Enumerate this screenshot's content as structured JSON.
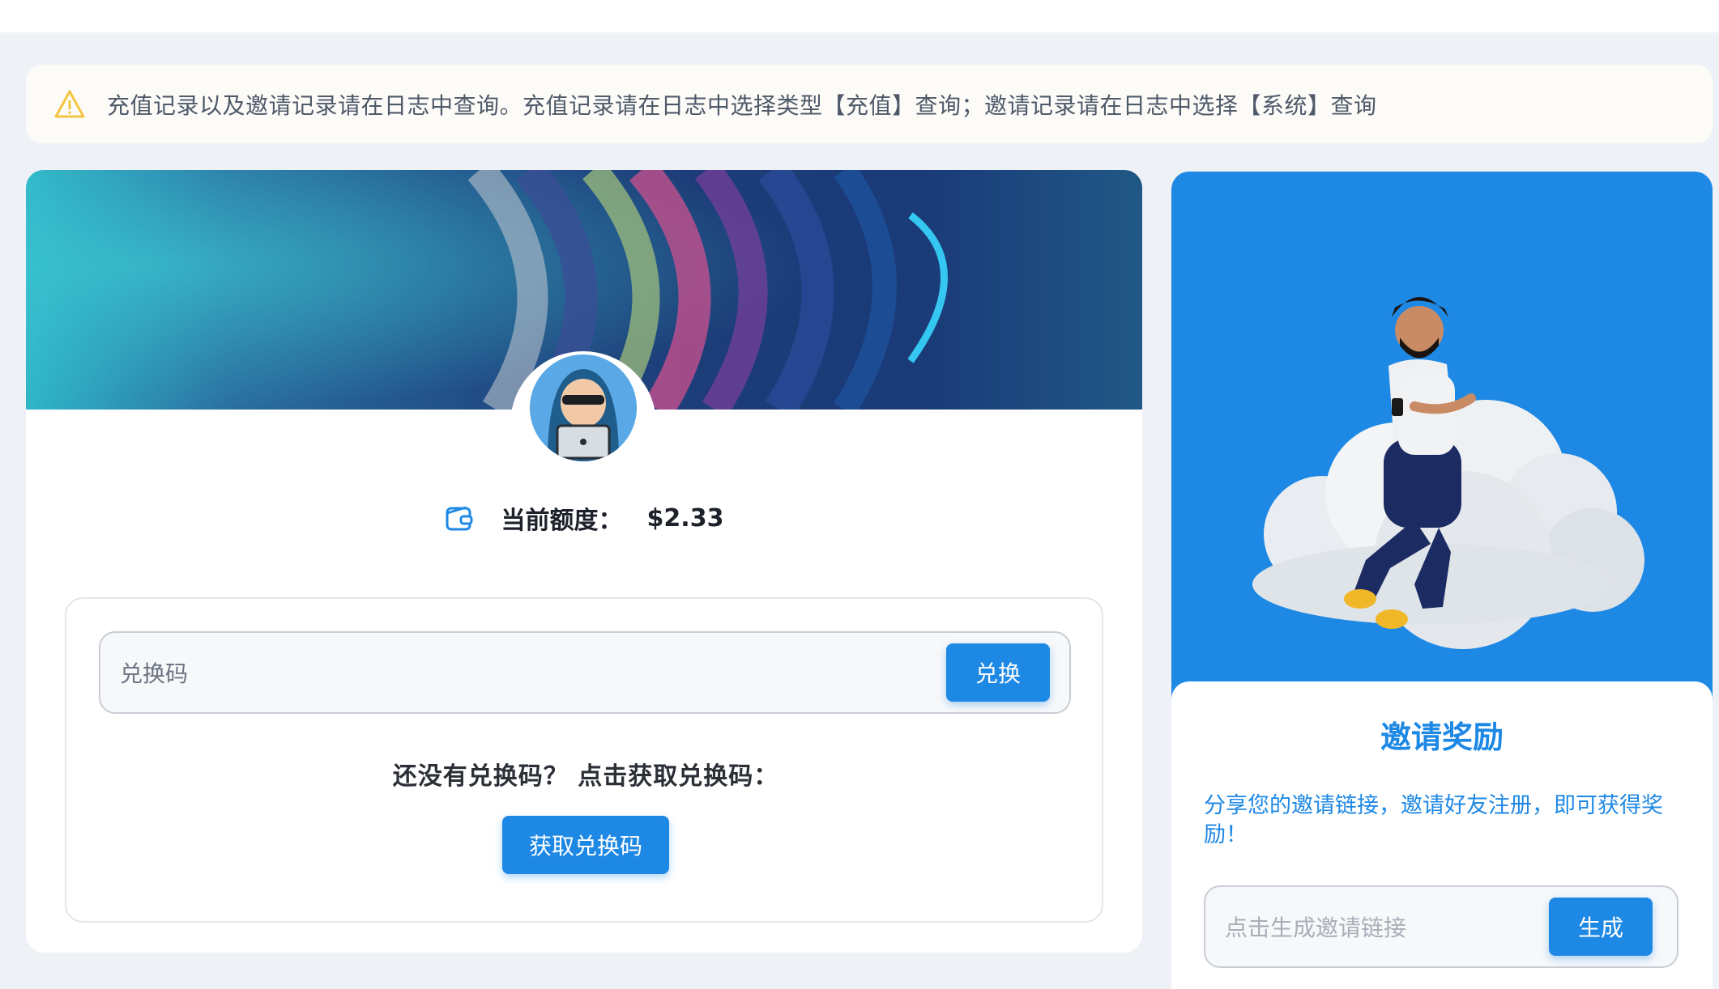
{
  "notice": {
    "icon": "warning-triangle-icon",
    "text": "充值记录以及邀请记录请在日志中查询。充值记录请在日志中选择类型【充值】查询；邀请记录请在日志中选择【系统】查询"
  },
  "wallet": {
    "icon": "wallet-icon",
    "label": "当前额度：",
    "amount": "$2.33"
  },
  "redeem": {
    "placeholder": "兑换码",
    "button_label": "兑换",
    "hint": "还没有兑换码？ 点击获取兑换码：",
    "get_code_label": "获取兑换码"
  },
  "invite": {
    "title": "邀请奖励",
    "description": "分享您的邀请链接，邀请好友注册，即可获得奖励！",
    "placeholder": "点击生成邀请链接",
    "button_label": "生成"
  },
  "colors": {
    "accent": "#1e88e5",
    "page_bg": "#eef1f6",
    "warning": "#f5c542"
  }
}
